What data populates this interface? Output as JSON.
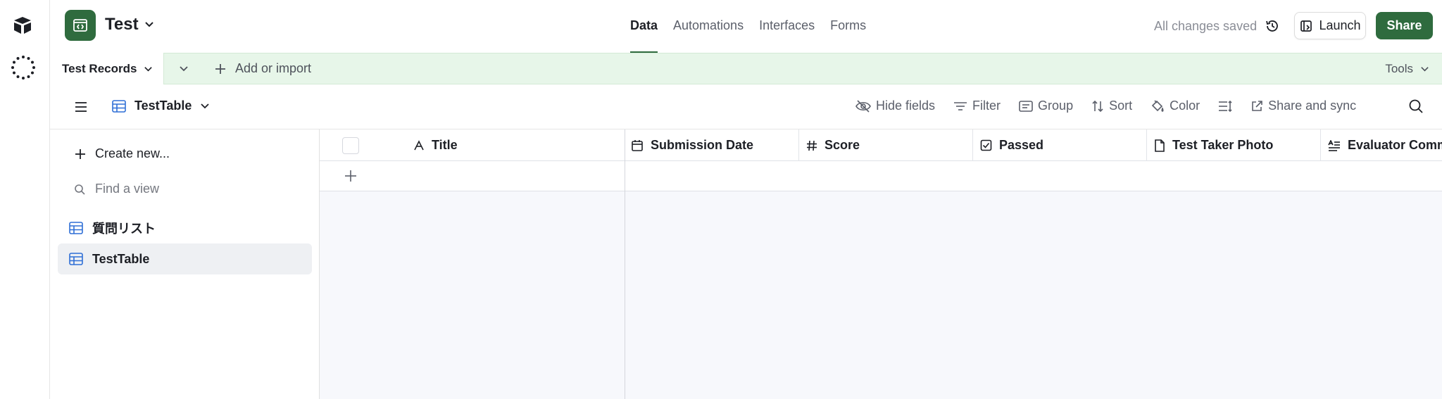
{
  "app": {
    "name": "Test",
    "icon": "code-window-icon",
    "brand_color": "#2f6b3e"
  },
  "nav": {
    "tabs": [
      "Data",
      "Automations",
      "Interfaces",
      "Forms"
    ],
    "active": "Data"
  },
  "header": {
    "status": "All changes saved",
    "launch_label": "Launch",
    "share_label": "Share"
  },
  "tabbar": {
    "table_tab": "Test Records",
    "add_import": "Add or import",
    "tools": "Tools",
    "bg_color": "#e7f6e9"
  },
  "viewbar": {
    "current_view": "TestTable",
    "tools": {
      "hide_fields": "Hide fields",
      "filter": "Filter",
      "group": "Group",
      "sort": "Sort",
      "color": "Color",
      "share_sync": "Share and sync"
    }
  },
  "sidebar": {
    "create_new": "Create new...",
    "find_view": "Find a view",
    "views": [
      {
        "label": "質問リスト",
        "selected": false
      },
      {
        "label": "TestTable",
        "selected": true
      }
    ]
  },
  "grid": {
    "columns": [
      {
        "label": "Title",
        "type": "text",
        "icon": "text-field-icon"
      },
      {
        "label": "Submission Date",
        "type": "date",
        "icon": "calendar-icon"
      },
      {
        "label": "Score",
        "type": "number",
        "icon": "hash-icon"
      },
      {
        "label": "Passed",
        "type": "checkbox",
        "icon": "checkbox-icon"
      },
      {
        "label": "Test Taker Photo",
        "type": "attachment",
        "icon": "document-icon"
      },
      {
        "label": "Evaluator Comme",
        "type": "long-text",
        "icon": "long-text-icon"
      }
    ],
    "rows": []
  }
}
